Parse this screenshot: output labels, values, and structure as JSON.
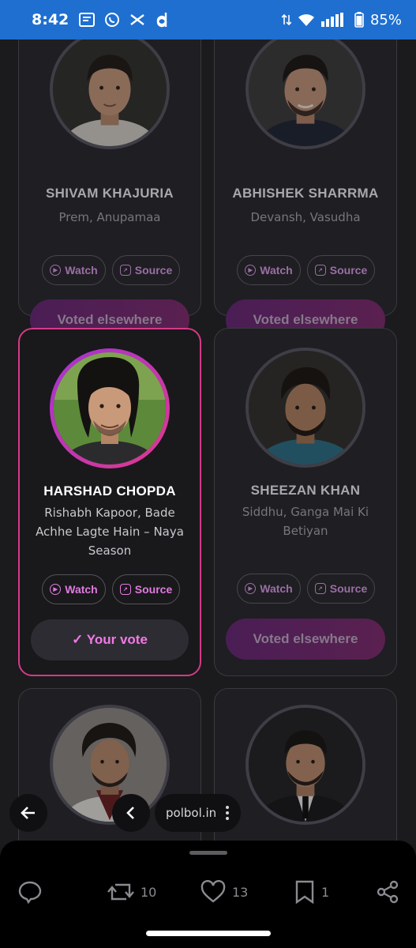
{
  "status_bar": {
    "time": "8:42",
    "battery": "85%"
  },
  "cards": [
    {
      "name": "SHIVAM KHAJURIA",
      "show": "Prem, Anupamaa",
      "watch": "Watch",
      "source": "Source",
      "vote_label": "Voted elsewhere"
    },
    {
      "name": "ABHISHEK SHARRMA",
      "show": "Devansh, Vasudha",
      "watch": "Watch",
      "source": "Source",
      "vote_label": "Voted elsewhere"
    },
    {
      "name": "HARSHAD CHOPDA",
      "show": "Rishabh Kapoor, Bade Achhe Lagte Hain – Naya Season",
      "watch": "Watch",
      "source": "Source",
      "vote_label": "✓ Your vote"
    },
    {
      "name": "SHEEZAN KHAN",
      "show": "Siddhu, Ganga Mai Ki Betiyan",
      "watch": "Watch",
      "source": "Source",
      "vote_label": "Voted elsewhere"
    }
  ],
  "browser": {
    "url": "polbol.in"
  },
  "actions": {
    "reposts": "10",
    "likes": "13",
    "bookmarks": "1"
  },
  "colors": {
    "status_bar": "#1e6fd0",
    "selected_border": "#d43a87",
    "accent_text": "#f07ae6"
  }
}
